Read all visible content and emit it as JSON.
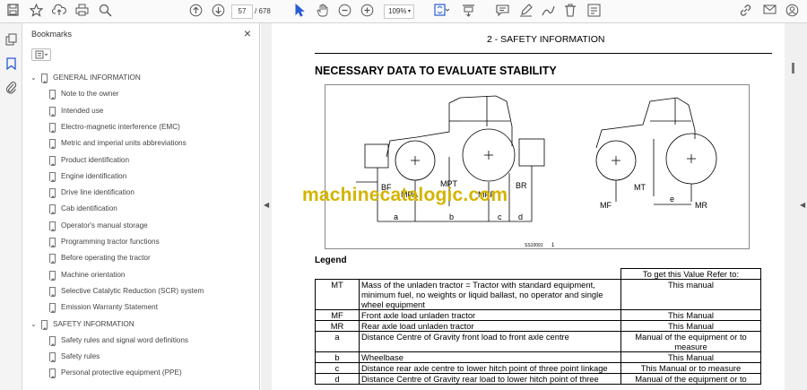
{
  "toolbar": {
    "page_current": "57",
    "page_total": "/ 678",
    "zoom": "109%"
  },
  "bookmarks": {
    "title": "Bookmarks",
    "close": "×",
    "items": [
      {
        "label": "GENERAL INFORMATION",
        "level": 0
      },
      {
        "label": "Note to the owner",
        "level": 1
      },
      {
        "label": "Intended use",
        "level": 1
      },
      {
        "label": "Electro-magnetic interference (EMC)",
        "level": 1
      },
      {
        "label": "Metric and imperial units abbreviations",
        "level": 1
      },
      {
        "label": "Product identification",
        "level": 1
      },
      {
        "label": "Engine identification",
        "level": 1
      },
      {
        "label": "Drive line identification",
        "level": 1
      },
      {
        "label": "Cab identification",
        "level": 1
      },
      {
        "label": "Operator's manual storage",
        "level": 1
      },
      {
        "label": "Programming tractor functions",
        "level": 1
      },
      {
        "label": "Before operating the tractor",
        "level": 1
      },
      {
        "label": "Machine orientation",
        "level": 1
      },
      {
        "label": "Selective Catalytic Reduction (SCR) system",
        "level": 1
      },
      {
        "label": "Emission Warranty Statement",
        "level": 1
      },
      {
        "label": "SAFETY INFORMATION",
        "level": 0
      },
      {
        "label": "Safety rules and signal word definitions",
        "level": 1
      },
      {
        "label": "Safety rules",
        "level": 1
      },
      {
        "label": "Personal protective equipment (PPE)",
        "level": 1
      }
    ]
  },
  "document": {
    "header": "2 - SAFETY INFORMATION",
    "section_title": "NECESSARY DATA TO EVALUATE STABILITY",
    "legend_title": "Legend",
    "watermark": "machinecatalogic.com",
    "figure": {
      "labels": {
        "BF": "BF",
        "MPA": "MPA",
        "MPT": "MPT",
        "MPP": "MPP",
        "BR": "BR",
        "a": "a",
        "b": "b",
        "c": "c",
        "d": "d",
        "MT": "MT",
        "MF": "MF",
        "MR": "MR",
        "e": "e",
        "code": "SS10091",
        "num": "1"
      }
    },
    "table": {
      "header_right": "To get this Value Refer to:",
      "rows": [
        {
          "key": "MT",
          "desc": "Mass of the unladen tractor = Tractor with standard equipment, minimum fuel, no weights or liquid ballast, no operator and single wheel equipment",
          "ref": "This manual"
        },
        {
          "key": "MF",
          "desc": "Front axle load unladen tractor",
          "ref": "This Manual"
        },
        {
          "key": "MR",
          "desc": "Rear axle load unladen tractor",
          "ref": "This Manual"
        },
        {
          "key": "a",
          "desc": "Distance Centre of Gravity front load to front axle centre",
          "ref": "Manual of the equipment or to measure"
        },
        {
          "key": "b",
          "desc": "Wheelbase",
          "ref": "This Manual"
        },
        {
          "key": "c",
          "desc": "Distance rear axle centre to lower hitch point of three point linkage",
          "ref": "This Manual or to measure"
        },
        {
          "key": "d",
          "desc": "Distance Centre of Gravity rear load to lower hitch point of three",
          "ref": "Manual of the equipment or to"
        }
      ]
    }
  }
}
